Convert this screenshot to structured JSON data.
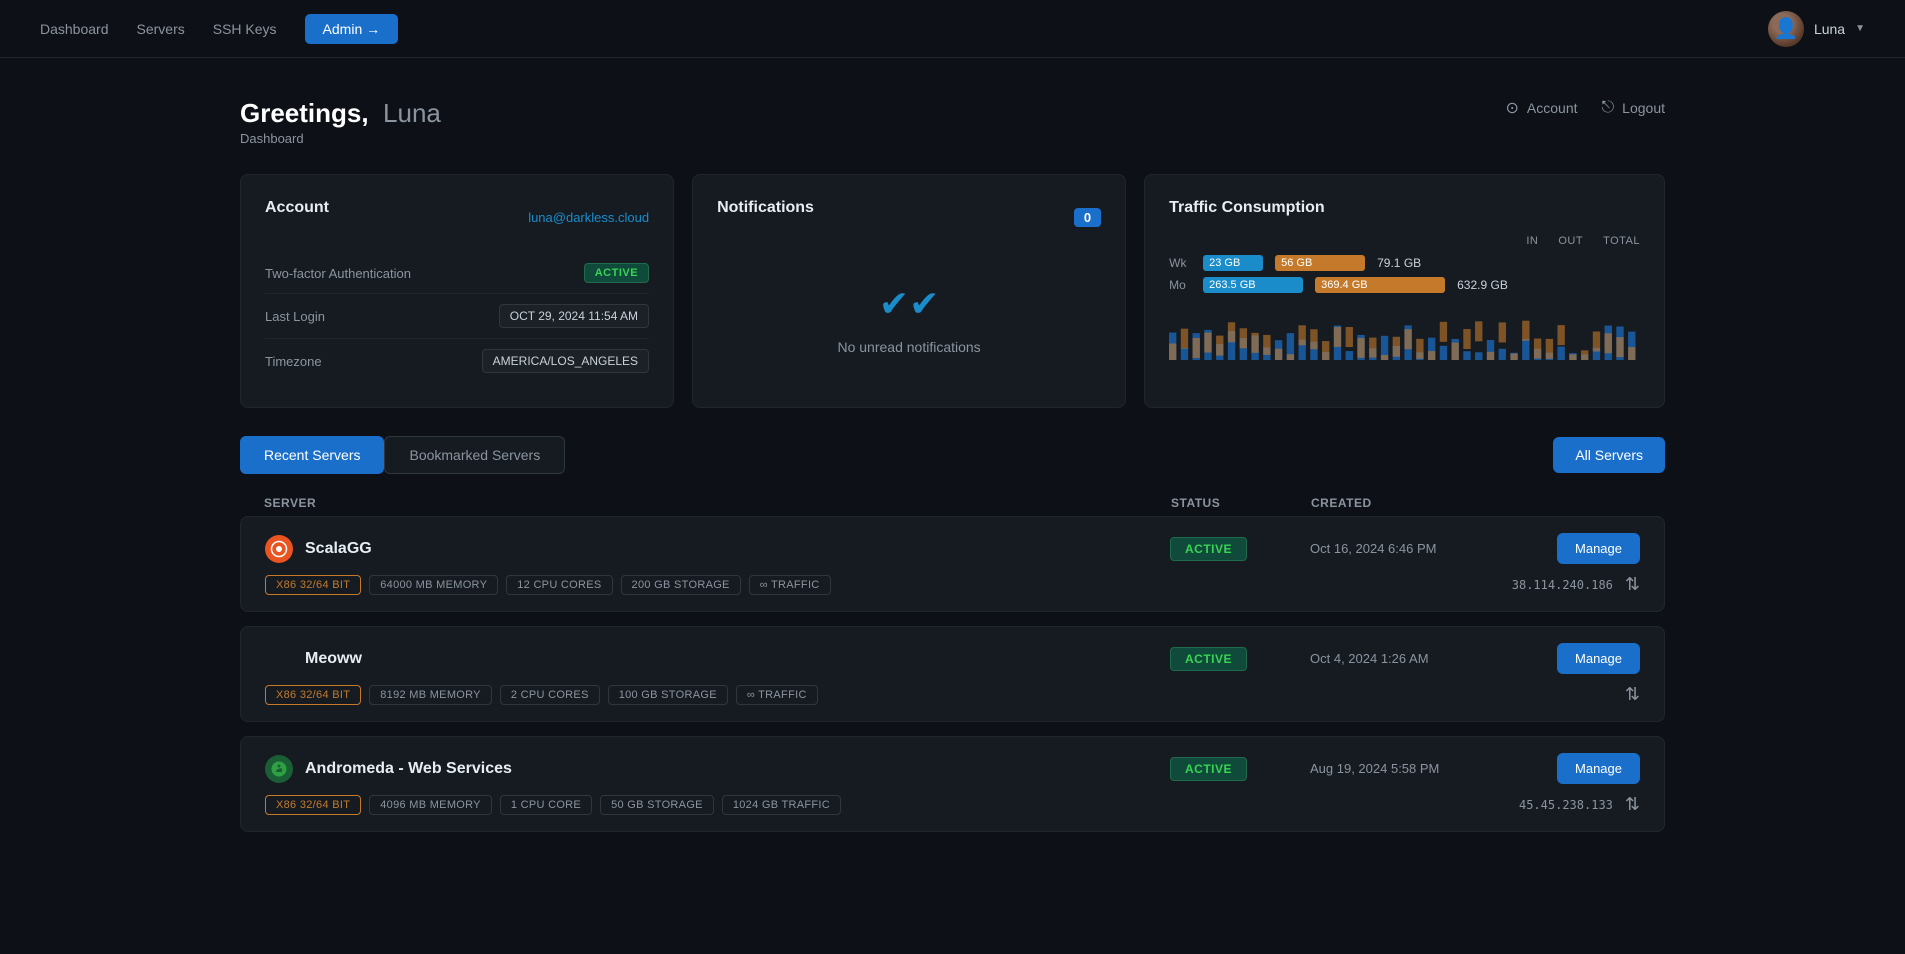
{
  "nav": {
    "links": [
      "Dashboard",
      "Servers",
      "SSH Keys"
    ],
    "admin_btn": "Admin →",
    "username": "Luna",
    "dropdown_arrow": "▼"
  },
  "greeting": {
    "bold": "Greetings,",
    "name": "Luna",
    "breadcrumb": "Dashboard"
  },
  "header_actions": {
    "account_label": "Account",
    "logout_label": "Logout"
  },
  "account_card": {
    "title": "Account",
    "email": "luna@darkless.cloud",
    "rows": [
      {
        "label": "Two-factor Authentication",
        "value": "ACTIVE",
        "type": "badge-active"
      },
      {
        "label": "Last Login",
        "value": "OCT 29, 2024 11:54 AM",
        "type": "badge-value"
      },
      {
        "label": "Timezone",
        "value": "AMERICA/LOS_ANGELES",
        "type": "badge-value"
      }
    ]
  },
  "notifications_card": {
    "title": "Notifications",
    "count": "0",
    "empty_message": "No unread notifications"
  },
  "traffic_card": {
    "title": "Traffic Consumption",
    "legend": {
      "in": "IN",
      "out": "OUT",
      "total": "TOTAL"
    },
    "rows": [
      {
        "label": "Wk",
        "in": "23 GB",
        "out": "56 GB",
        "total": "79.1 GB",
        "in_w": 40,
        "out_w": 65
      },
      {
        "label": "Mo",
        "in": "263.5 GB",
        "out": "369.4 GB",
        "total": "632.9 GB",
        "in_w": 90,
        "out_w": 120
      }
    ]
  },
  "tabs": {
    "recent": "Recent Servers",
    "bookmarked": "Bookmarked Servers",
    "all_servers": "All Servers"
  },
  "table_headers": {
    "server": "SERVER",
    "status": "STATUS",
    "created": "CREATED"
  },
  "servers": [
    {
      "name": "ScalaGG",
      "icon_type": "ubuntu",
      "icon_char": "🔴",
      "status": "ACTIVE",
      "created": "Oct 16, 2024 6:46 PM",
      "tags": [
        {
          "label": "X86 32/64 BIT",
          "orange": true
        },
        {
          "label": "64000 MB MEMORY",
          "orange": false
        },
        {
          "label": "12 CPU CORES",
          "orange": false
        },
        {
          "label": "200 GB STORAGE",
          "orange": false
        },
        {
          "label": "∞ TRAFFIC",
          "orange": false
        }
      ],
      "ip": "38.114.240.186",
      "bookmarked": false
    },
    {
      "name": "Meoww",
      "icon_type": null,
      "icon_char": null,
      "status": "ACTIVE",
      "created": "Oct 4, 2024 1:26 AM",
      "tags": [
        {
          "label": "X86 32/64 BIT",
          "orange": true
        },
        {
          "label": "8192 MB MEMORY",
          "orange": false
        },
        {
          "label": "2 CPU CORES",
          "orange": false
        },
        {
          "label": "100 GB STORAGE",
          "orange": false
        },
        {
          "label": "∞ TRAFFIC",
          "orange": false
        }
      ],
      "ip": null,
      "bookmarked": false
    },
    {
      "name": "Andromeda - Web Services",
      "icon_type": "green",
      "icon_char": "🌀",
      "status": "ACTIVE",
      "created": "Aug 19, 2024 5:58 PM",
      "tags": [
        {
          "label": "X86 32/64 BIT",
          "orange": true
        },
        {
          "label": "4096 MB MEMORY",
          "orange": false
        },
        {
          "label": "1 CPU CORE",
          "orange": false
        },
        {
          "label": "50 GB STORAGE",
          "orange": false
        },
        {
          "label": "1024 GB TRAFFIC",
          "orange": false
        }
      ],
      "ip": "45.45.238.133",
      "bookmarked": false
    }
  ]
}
